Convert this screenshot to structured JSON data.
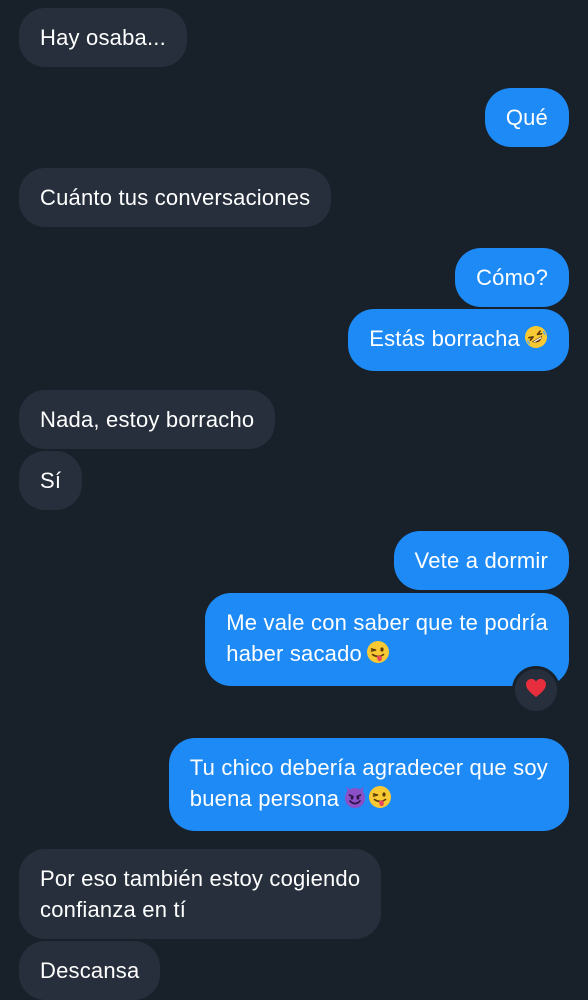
{
  "messages": [
    {
      "text": "Hay osaba..."
    },
    {
      "text": "Qué"
    },
    {
      "text": "Cuánto tus conversaciones"
    },
    {
      "text": "Cómo?"
    },
    {
      "text": "Estás borracha"
    },
    {
      "text": "Nada, estoy borracho"
    },
    {
      "text": "Sí"
    },
    {
      "text": "Vete a dormir"
    },
    {
      "lines": [
        "Me vale con saber que te podría",
        "haber sacado"
      ]
    },
    {
      "lines": [
        "Tu chico debería agradecer que soy",
        "buena persona"
      ]
    },
    {
      "lines": [
        "Por eso también estoy cogiendo",
        "confianza en tí"
      ]
    },
    {
      "text": "Descansa"
    }
  ],
  "icons": {
    "laugh": "rolling-on-floor-laughing-emoji",
    "wink_tongue": "winking-face-with-tongue-emoji",
    "devil": "smiling-face-with-horns-emoji",
    "reaction": "red-heart-icon"
  },
  "colors": {
    "background": "#18202a",
    "incoming_bubble": "#262f3b",
    "outgoing_bubble": "#1d8af5",
    "heart": "#e62e3e"
  }
}
